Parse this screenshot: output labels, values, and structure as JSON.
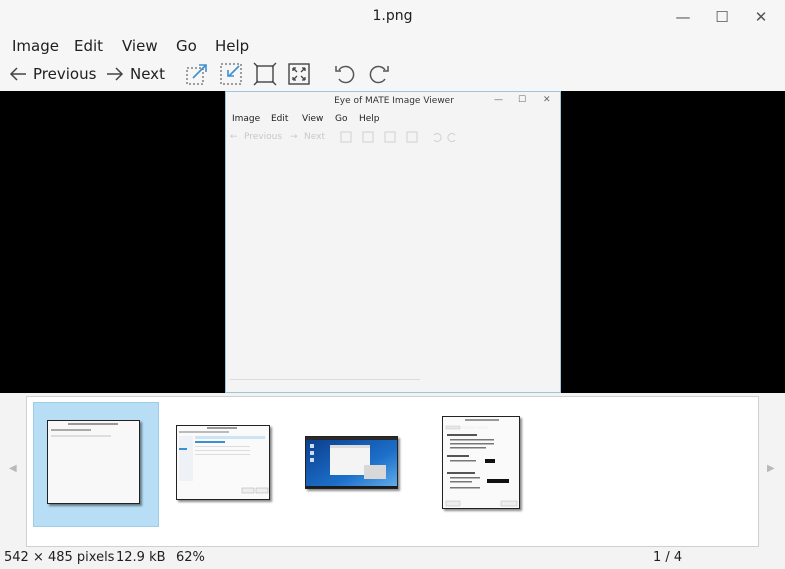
{
  "window": {
    "title": "1.png",
    "controls": {
      "minimize": "—",
      "maximize": "☐",
      "close": "✕"
    }
  },
  "menubar": [
    "Image",
    "Edit",
    "View",
    "Go",
    "Help"
  ],
  "toolbar": {
    "previous_label": "Previous",
    "next_label": "Next",
    "icons": [
      "arrow-left-icon",
      "arrow-right-icon",
      "zoom-in-icon",
      "zoom-out-icon",
      "fit-icon",
      "fullscreen-icon",
      "rotate-left-icon",
      "rotate-right-icon"
    ]
  },
  "viewer": {
    "inner_window": {
      "title": "Eye of MATE Image Viewer",
      "menu": [
        "Image",
        "Edit",
        "View",
        "Go",
        "Help"
      ],
      "previous_label": "Previous",
      "next_label": "Next"
    }
  },
  "gallery": {
    "prev_arrow": "◀",
    "next_arrow": "▶",
    "selected_index": 0,
    "thumbnails": [
      {
        "label": "Eye of MATE Image Viewer"
      },
      {
        "label": "file chooser"
      },
      {
        "label": "desktop screenshot"
      },
      {
        "label": "Eye of MATE Preferences"
      }
    ]
  },
  "statusbar": {
    "dimensions": "542 × 485 pixels",
    "size": "12.9 kB",
    "zoom": "62%",
    "position": "1 / 4"
  },
  "colors": {
    "chrome": "#f6f6f6",
    "accent": "#3d8fd0",
    "selection": "#b7def4",
    "viewer_bg": "#000000"
  }
}
